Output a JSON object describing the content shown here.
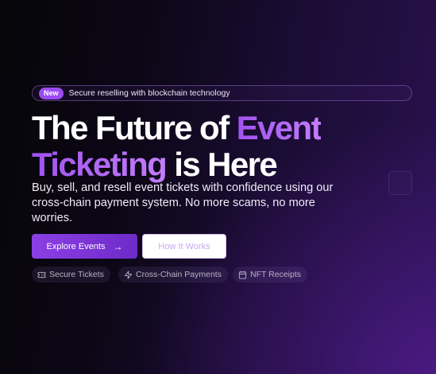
{
  "announcement": {
    "badge": "New",
    "text": "Secure reselling with blockchain technology"
  },
  "hero": {
    "headline_part1": "The Future of ",
    "headline_highlight1": "Event",
    "headline_highlight2": "Ticketing",
    "headline_part2": " is Here",
    "subtitle": "Buy, sell, and resell event tickets with confidence using our cross-chain payment system. No more scams, no more worries."
  },
  "buttons": {
    "primary_label": "Explore Events",
    "secondary_label": "How It Works"
  },
  "features": [
    {
      "label": "Secure Tickets",
      "icon": "ticket-icon"
    },
    {
      "label": "Cross-Chain Payments",
      "icon": "lightning-icon"
    },
    {
      "label": "NFT Receipts",
      "icon": "calendar-icon"
    }
  ],
  "colors": {
    "accent": "#9a4cf0",
    "headline_gradient_start": "#a052f0",
    "headline_gradient_end": "#c37dfa",
    "background_dark": "#060509",
    "background_glow": "#4a1a82"
  }
}
